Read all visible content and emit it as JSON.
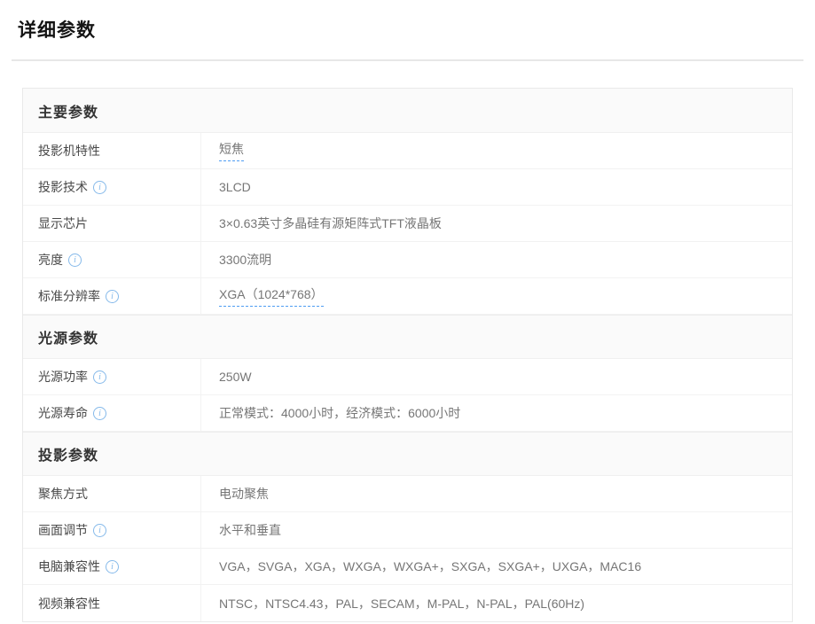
{
  "page": {
    "title": "详细参数"
  },
  "colors": {
    "accent_blue": "#4f9df2",
    "info_icon_blue": "#85b9ea",
    "section_header_bg": "#fafafa",
    "label_text": "#494949",
    "value_text": "#767676",
    "border": "#e9e9e9"
  },
  "icons": {
    "info": "info-icon"
  },
  "sections": [
    {
      "title": "主要参数",
      "rows": [
        {
          "label": "投影机特性",
          "value": "短焦"
        },
        {
          "label": "投影技术",
          "value": "3LCD"
        },
        {
          "label": "显示芯片",
          "value": "3×0.63英寸多晶硅有源矩阵式TFT液晶板"
        },
        {
          "label": "亮度",
          "value": "3300流明"
        },
        {
          "label": "标准分辨率",
          "value": "XGA（1024*768）"
        }
      ]
    },
    {
      "title": "光源参数",
      "rows": [
        {
          "label": "光源功率",
          "value": "250W"
        },
        {
          "label": "光源寿命",
          "value": "正常模式：4000小时，经济模式：6000小时"
        }
      ]
    },
    {
      "title": "投影参数",
      "rows": [
        {
          "label": "聚焦方式",
          "value": "电动聚焦"
        },
        {
          "label": "画面调节",
          "value": "水平和垂直"
        },
        {
          "label": "电脑兼容性",
          "value": "VGA，SVGA，XGA，WXGA，WXGA+，SXGA，SXGA+，UXGA，MAC16"
        },
        {
          "label": "视频兼容性",
          "value": "NTSC，NTSC4.43，PAL，SECAM，M-PAL，N-PAL，PAL(60Hz)"
        }
      ]
    }
  ],
  "info_glyph": "i"
}
